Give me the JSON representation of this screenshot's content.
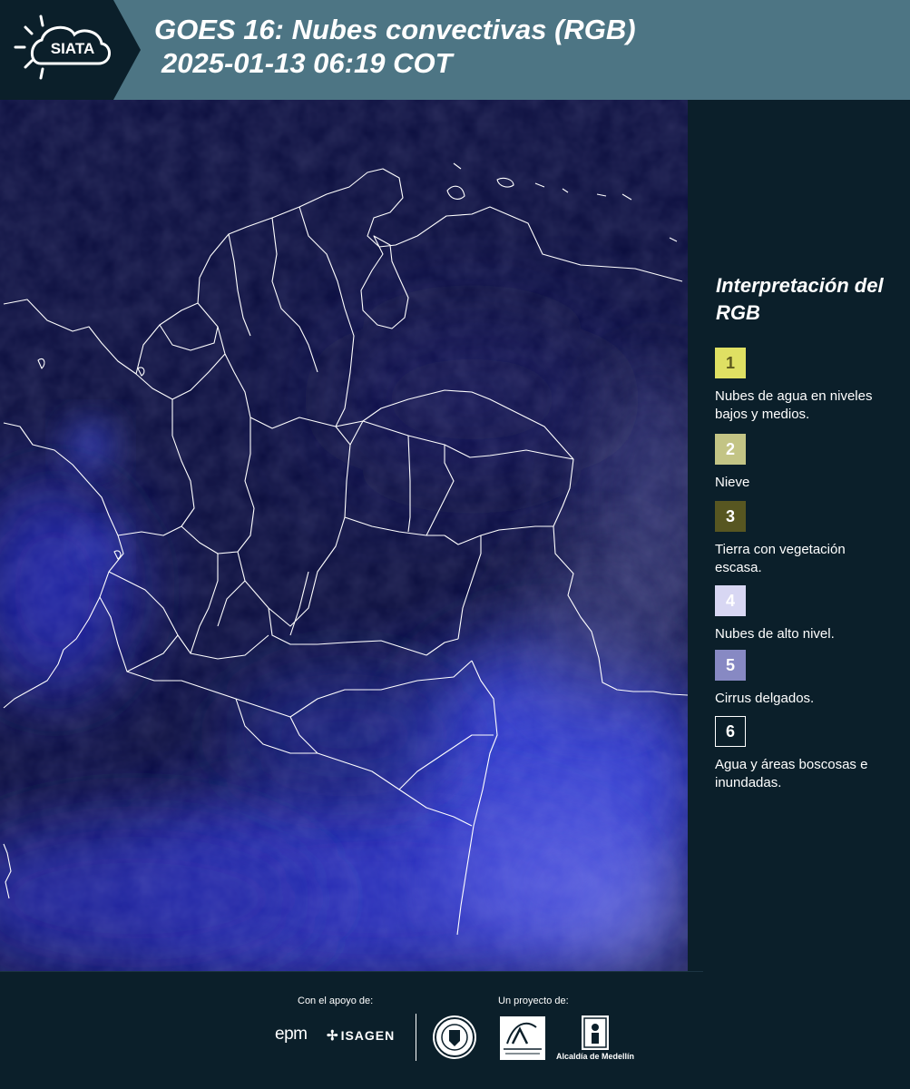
{
  "header": {
    "logo_text": "SIATA",
    "title_line1": "GOES 16: Nubes convectivas (RGB)",
    "title_line2": "2025-01-13 06:19 COT",
    "bg_color": "#4d7584"
  },
  "legend": {
    "title": "Interpretación del RGB",
    "items": [
      {
        "number": "1",
        "label": "Nubes de agua en niveles bajos y medios.",
        "color": "#dfe063",
        "text_color": "#5e5a1e"
      },
      {
        "number": "2",
        "label": "Nieve",
        "color": "#c3c485",
        "text_color": "#ffffff"
      },
      {
        "number": "3",
        "label": "Tierra con vegetación escasa.",
        "color": "#575621",
        "text_color": "#ffffff"
      },
      {
        "number": "4",
        "label": "Nubes de alto nivel.",
        "color": "#d8d7f3",
        "text_color": "#ffffff"
      },
      {
        "number": "5",
        "label": "Cirrus delgados.",
        "color": "#8789c3",
        "text_color": "#ffffff"
      },
      {
        "number": "6",
        "label": "Agua y áreas boscosas e inundadas.",
        "color": "#0b1f2a",
        "text_color": "#ffffff"
      }
    ]
  },
  "footer": {
    "support_label": "Con el apoyo de:",
    "project_label": "Un proyecto de:",
    "logo_epm": "epm",
    "logo_isagen": "ISAGEN",
    "logo_alcaldia": "Alcaldía de Medellín"
  }
}
